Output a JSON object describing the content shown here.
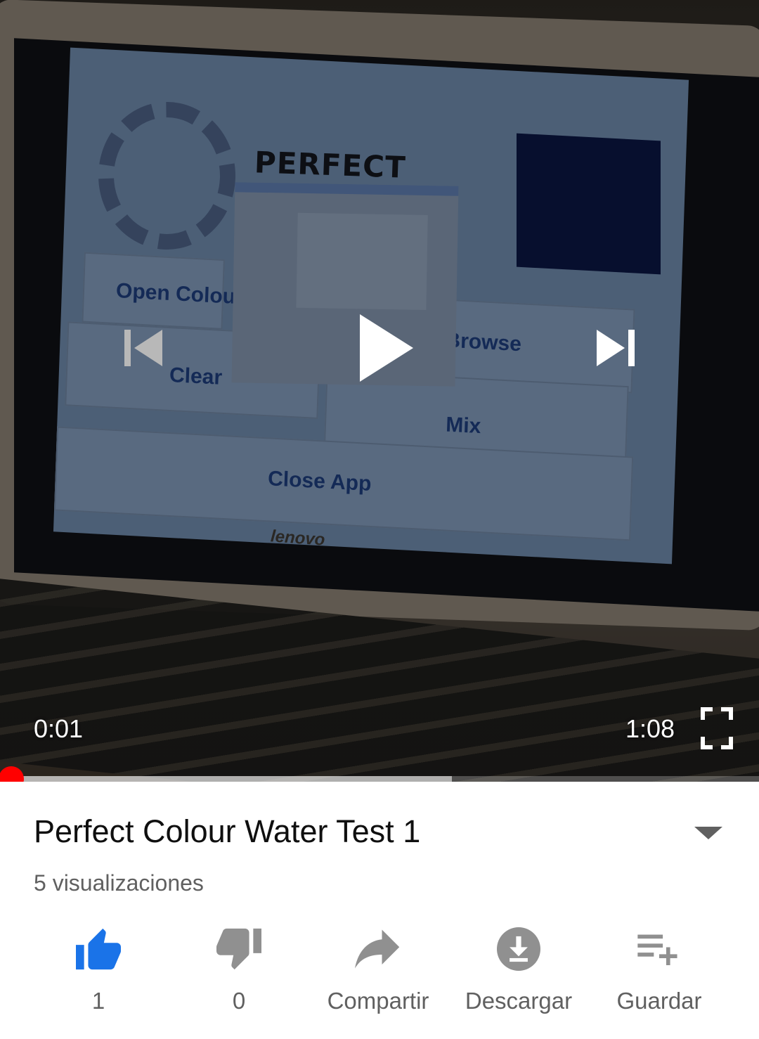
{
  "video": {
    "current_time": "0:01",
    "duration": "1:08",
    "progress_fraction": 0.015,
    "buffered_fraction": 0.595,
    "frame_text": {
      "app_title": "PERFECT",
      "open_colour": "Open Colour",
      "clear": "Clear",
      "browse": "Browse",
      "mix": "Mix",
      "close_app": "Close App",
      "laptop_brand": "lenovo"
    }
  },
  "info": {
    "title": "Perfect Colour Water Test 1",
    "views": "5 visualizaciones"
  },
  "actions": {
    "like": {
      "label": "1",
      "icon": "thumbs-up-icon",
      "color": "#1a73e8"
    },
    "dislike": {
      "label": "0",
      "icon": "thumbs-down-icon"
    },
    "share": {
      "label": "Compartir",
      "icon": "share-icon"
    },
    "download": {
      "label": "Descargar",
      "icon": "download-icon"
    },
    "save": {
      "label": "Guardar",
      "icon": "playlist-add-icon"
    }
  },
  "colors": {
    "accent_red": "#ff0000",
    "like_blue": "#1a73e8",
    "icon_gray": "#909090",
    "text_secondary": "#606060"
  }
}
